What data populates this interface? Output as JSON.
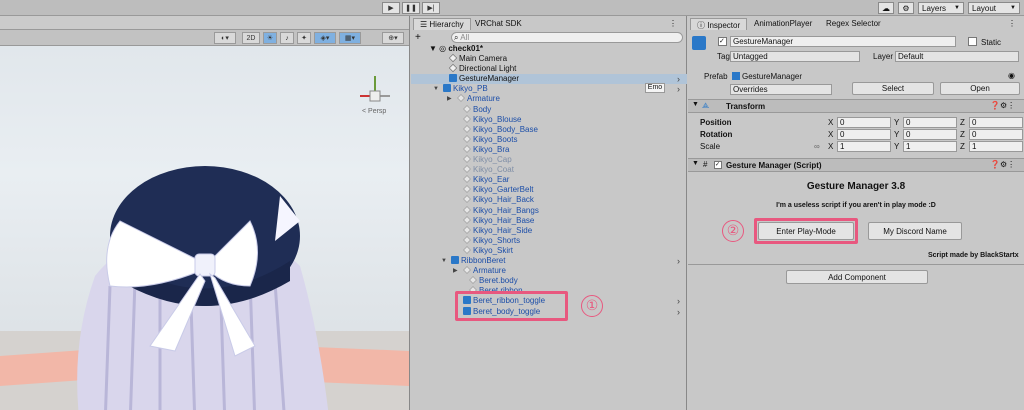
{
  "toolbar": {
    "play_icon": "play-icon",
    "pause_icon": "pause-icon",
    "step_icon": "step-icon",
    "layers_label": "Layers",
    "layout_label": "Layout"
  },
  "scene": {
    "mode_2d": "2D",
    "gizmo_label": "< Persp"
  },
  "hierarchy": {
    "tabs": [
      "Hierarchy",
      "VRChat SDK"
    ],
    "search_placeholder": "All",
    "add_label": "+",
    "scene_name": "check01*",
    "emo_badge": "Emo",
    "items": [
      {
        "label": "Main Camera",
        "style": "normal"
      },
      {
        "label": "Directional Light",
        "style": "normal"
      },
      {
        "label": "GestureManager",
        "style": "normal"
      },
      {
        "label": "Kikyo_PB",
        "style": "blue"
      },
      {
        "label": "Armature",
        "style": "blue"
      },
      {
        "label": "Body",
        "style": "blue"
      },
      {
        "label": "Kikyo_Blouse",
        "style": "blue"
      },
      {
        "label": "Kikyo_Body_Base",
        "style": "blue"
      },
      {
        "label": "Kikyo_Boots",
        "style": "blue"
      },
      {
        "label": "Kikyo_Bra",
        "style": "blue"
      },
      {
        "label": "Kikyo_Cap",
        "style": "dim"
      },
      {
        "label": "Kikyo_Coat",
        "style": "dim"
      },
      {
        "label": "Kikyo_Ear",
        "style": "blue"
      },
      {
        "label": "Kikyo_GarterBelt",
        "style": "blue"
      },
      {
        "label": "Kikyo_Hair_Back",
        "style": "blue"
      },
      {
        "label": "Kikyo_Hair_Bangs",
        "style": "blue"
      },
      {
        "label": "Kikyo_Hair_Base",
        "style": "blue"
      },
      {
        "label": "Kikyo_Hair_Side",
        "style": "blue"
      },
      {
        "label": "Kikyo_Shorts",
        "style": "blue"
      },
      {
        "label": "Kikyo_Skirt",
        "style": "blue"
      },
      {
        "label": "RibbonBeret",
        "style": "blue"
      },
      {
        "label": "Armature",
        "style": "blue"
      },
      {
        "label": "Beret.body",
        "style": "blue"
      },
      {
        "label": "Beret.ribbon",
        "style": "blue"
      },
      {
        "label": "Beret_ribbon_toggle",
        "style": "blue"
      },
      {
        "label": "Beret_body_toggle",
        "style": "blue"
      }
    ],
    "annotation_1": "①"
  },
  "inspector": {
    "tabs": [
      "Inspector",
      "AnimationPlayer",
      "Regex Selector"
    ],
    "object_name": "GestureManager",
    "static_label": "Static",
    "tag_label": "Tag",
    "tag_value": "Untagged",
    "layer_label": "Layer",
    "layer_value": "Default",
    "prefab_label": "Prefab",
    "prefab_value": "GestureManager",
    "overrides_label": "Overrides",
    "select_label": "Select",
    "open_label": "Open",
    "transform_title": "Transform",
    "position_label": "Position",
    "rotation_label": "Rotation",
    "scale_label": "Scale",
    "axis_x": "X",
    "axis_y": "Y",
    "axis_z": "Z",
    "position": [
      "0",
      "0",
      "0"
    ],
    "rotation": [
      "0",
      "0",
      "0"
    ],
    "scale": [
      "1",
      "1",
      "1"
    ],
    "script_title": "Gesture Manager (Script)",
    "gm_title": "Gesture Manager 3.8",
    "gm_subtitle": "I'm a useless script if you aren't in play mode :D",
    "enter_play_label": "Enter Play-Mode",
    "discord_label": "My Discord Name",
    "made_by": "Script made by BlackStartx",
    "add_component_label": "Add Component",
    "annotation_2": "②"
  }
}
